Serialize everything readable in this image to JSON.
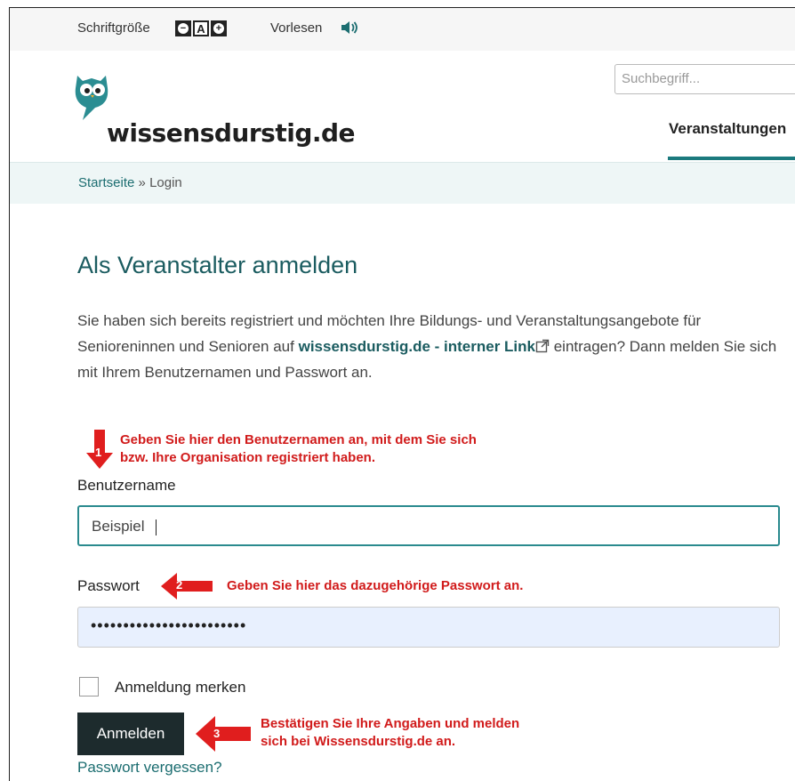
{
  "topbar": {
    "font_size_label": "Schriftgröße",
    "font_normal_label": "A",
    "read_aloud_label": "Vorlesen"
  },
  "header": {
    "logo_text": "wissensdurstig.de",
    "search_placeholder": "Suchbegriff...",
    "nav_item": "Veranstaltungen"
  },
  "breadcrumb": {
    "home": "Startseite",
    "separator": " » ",
    "current": "Login"
  },
  "main": {
    "title": "Als Veranstalter anmelden",
    "intro_before": "Sie haben sich bereits registriert und möchten Ihre Bildungs- und Veranstaltungsangebote für Senioreninnen und Senioren auf ",
    "intro_link": "wissensdurstig.de - interner Link",
    "intro_after": " eintragen? Dann melden Sie sich mit Ihrem Benutzernamen und Passwort an."
  },
  "form": {
    "username_label": "Benutzername",
    "username_value": "Beispiel",
    "password_label": "Passwort",
    "password_value": "••••••••••••••••••••••••",
    "remember_label": "Anmeldung merken",
    "submit_label": "Anmelden",
    "forgot_label": "Passwort vergessen?"
  },
  "annotations": {
    "arrow1_number": "1",
    "arrow1_line1": "Geben Sie hier den Benutzernamen an, mit dem Sie sich",
    "arrow1_line2": "bzw. Ihre Organisation registriert haben.",
    "arrow2_number": "2",
    "arrow2_text": "Geben Sie hier das dazugehörige Passwort an.",
    "arrow3_number": "3",
    "arrow3_line1": "Bestätigen Sie Ihre Angaben und melden",
    "arrow3_line2": "sich bei Wissensdurstig.de an."
  },
  "colors": {
    "brand_teal": "#1b7a7e",
    "heading_teal": "#1b5c60",
    "annotation_red": "#d11b1b",
    "button_dark": "#1d2b2d",
    "autofill_blue": "#e8f0fe"
  }
}
